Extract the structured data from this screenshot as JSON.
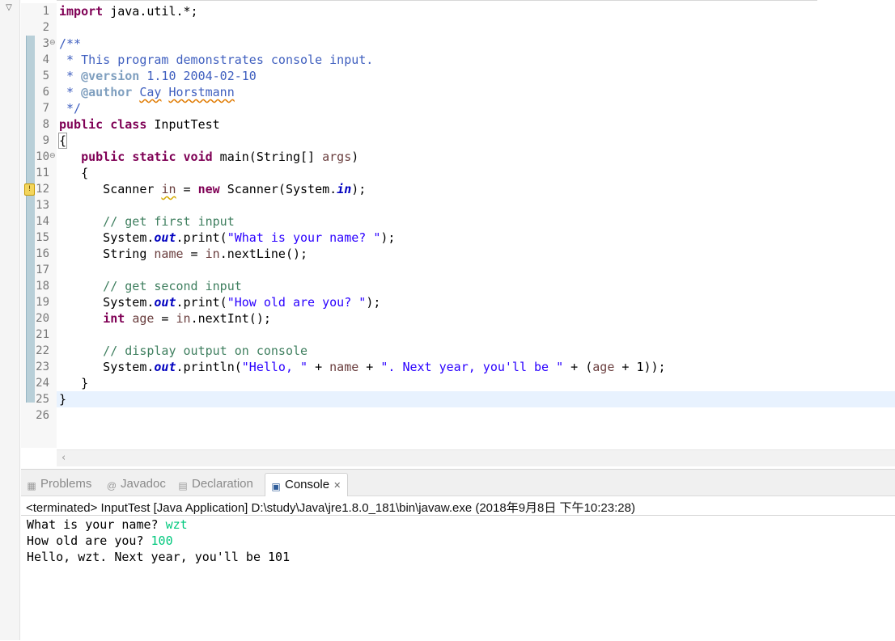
{
  "editor": {
    "lines": [
      {
        "n": "1",
        "fold": "",
        "segs": [
          {
            "t": "import",
            "c": "kw"
          },
          {
            "t": " java.util.*;",
            "c": ""
          }
        ]
      },
      {
        "n": "2",
        "fold": "",
        "segs": []
      },
      {
        "n": "3",
        "fold": "⊖",
        "segs": [
          {
            "t": "/**",
            "c": "jd"
          }
        ]
      },
      {
        "n": "4",
        "fold": "",
        "segs": [
          {
            "t": " * This program demonstrates console input.",
            "c": "jd"
          }
        ]
      },
      {
        "n": "5",
        "fold": "",
        "segs": [
          {
            "t": " * ",
            "c": "jd"
          },
          {
            "t": "@version",
            "c": "jt"
          },
          {
            "t": " 1.10 2004-02-10",
            "c": "jd"
          }
        ]
      },
      {
        "n": "6",
        "fold": "",
        "segs": [
          {
            "t": " * ",
            "c": "jd"
          },
          {
            "t": "@author",
            "c": "jt"
          },
          {
            "t": " ",
            "c": "jd"
          },
          {
            "t": "Cay",
            "c": "jd sq-r"
          },
          {
            "t": " ",
            "c": "jd"
          },
          {
            "t": "Horstmann",
            "c": "jd sq-r"
          }
        ]
      },
      {
        "n": "7",
        "fold": "",
        "segs": [
          {
            "t": " */",
            "c": "jd"
          }
        ]
      },
      {
        "n": "8",
        "fold": "",
        "segs": [
          {
            "t": "public",
            "c": "kw"
          },
          {
            "t": " ",
            "c": ""
          },
          {
            "t": "class",
            "c": "kw"
          },
          {
            "t": " InputTest",
            "c": ""
          }
        ]
      },
      {
        "n": "9",
        "fold": "",
        "segs": [
          {
            "t": "{",
            "c": "brace-box"
          }
        ]
      },
      {
        "n": "10",
        "fold": "⊖",
        "segs": [
          {
            "t": "   ",
            "c": ""
          },
          {
            "t": "public",
            "c": "kw"
          },
          {
            "t": " ",
            "c": ""
          },
          {
            "t": "static",
            "c": "kw"
          },
          {
            "t": " ",
            "c": ""
          },
          {
            "t": "void",
            "c": "kw"
          },
          {
            "t": " main(String[] ",
            "c": ""
          },
          {
            "t": "args",
            "c": "var"
          },
          {
            "t": ")",
            "c": ""
          }
        ]
      },
      {
        "n": "11",
        "fold": "",
        "segs": [
          {
            "t": "   {",
            "c": ""
          }
        ]
      },
      {
        "n": "12",
        "fold": "",
        "warn": true,
        "segs": [
          {
            "t": "      Scanner ",
            "c": ""
          },
          {
            "t": "in",
            "c": "var sq"
          },
          {
            "t": " = ",
            "c": ""
          },
          {
            "t": "new",
            "c": "kw"
          },
          {
            "t": " Scanner(System.",
            "c": ""
          },
          {
            "t": "in",
            "c": "fld"
          },
          {
            "t": ");",
            "c": ""
          }
        ]
      },
      {
        "n": "13",
        "fold": "",
        "segs": []
      },
      {
        "n": "14",
        "fold": "",
        "segs": [
          {
            "t": "      // get first input",
            "c": "cm"
          }
        ]
      },
      {
        "n": "15",
        "fold": "",
        "segs": [
          {
            "t": "      System.",
            "c": ""
          },
          {
            "t": "out",
            "c": "fld"
          },
          {
            "t": ".print(",
            "c": ""
          },
          {
            "t": "\"What is your name? \"",
            "c": "st"
          },
          {
            "t": ");",
            "c": ""
          }
        ]
      },
      {
        "n": "16",
        "fold": "",
        "segs": [
          {
            "t": "      String ",
            "c": ""
          },
          {
            "t": "name",
            "c": "var"
          },
          {
            "t": " = ",
            "c": ""
          },
          {
            "t": "in",
            "c": "var"
          },
          {
            "t": ".nextLine();",
            "c": ""
          }
        ]
      },
      {
        "n": "17",
        "fold": "",
        "segs": []
      },
      {
        "n": "18",
        "fold": "",
        "segs": [
          {
            "t": "      // get second input",
            "c": "cm"
          }
        ]
      },
      {
        "n": "19",
        "fold": "",
        "segs": [
          {
            "t": "      System.",
            "c": ""
          },
          {
            "t": "out",
            "c": "fld"
          },
          {
            "t": ".print(",
            "c": ""
          },
          {
            "t": "\"How old are you? \"",
            "c": "st"
          },
          {
            "t": ");",
            "c": ""
          }
        ]
      },
      {
        "n": "20",
        "fold": "",
        "segs": [
          {
            "t": "      ",
            "c": ""
          },
          {
            "t": "int",
            "c": "kw"
          },
          {
            "t": " ",
            "c": ""
          },
          {
            "t": "age",
            "c": "var"
          },
          {
            "t": " = ",
            "c": ""
          },
          {
            "t": "in",
            "c": "var"
          },
          {
            "t": ".nextInt();",
            "c": ""
          }
        ]
      },
      {
        "n": "21",
        "fold": "",
        "segs": []
      },
      {
        "n": "22",
        "fold": "",
        "segs": [
          {
            "t": "      // display output on console",
            "c": "cm"
          }
        ]
      },
      {
        "n": "23",
        "fold": "",
        "segs": [
          {
            "t": "      System.",
            "c": ""
          },
          {
            "t": "out",
            "c": "fld"
          },
          {
            "t": ".println(",
            "c": ""
          },
          {
            "t": "\"Hello, \"",
            "c": "st"
          },
          {
            "t": " + ",
            "c": ""
          },
          {
            "t": "name",
            "c": "var"
          },
          {
            "t": " + ",
            "c": ""
          },
          {
            "t": "\". Next year, you'll be \"",
            "c": "st"
          },
          {
            "t": " + (",
            "c": ""
          },
          {
            "t": "age",
            "c": "var"
          },
          {
            "t": " + 1));",
            "c": ""
          }
        ]
      },
      {
        "n": "24",
        "fold": "",
        "segs": [
          {
            "t": "   }",
            "c": ""
          }
        ]
      },
      {
        "n": "25",
        "fold": "",
        "segs": [
          {
            "t": "}",
            "c": ""
          }
        ]
      },
      {
        "n": "26",
        "fold": "",
        "segs": []
      }
    ],
    "scroll_left_icon": "‹"
  },
  "panel": {
    "tabs": [
      {
        "label": "Problems",
        "icon": "problems-icon",
        "glyph": "▦",
        "active": false
      },
      {
        "label": "Javadoc",
        "icon": "javadoc-icon",
        "glyph": "@",
        "active": false
      },
      {
        "label": "Declaration",
        "icon": "declaration-icon",
        "glyph": "▤",
        "active": false
      },
      {
        "label": "Console",
        "icon": "console-icon",
        "glyph": "▣",
        "active": true
      }
    ],
    "close_glyph": "✕",
    "console_status": "<terminated> InputTest [Java Application] D:\\study\\Java\\jre1.8.0_181\\bin\\javaw.exe (2018年9月8日 下午10:23:28)",
    "output": [
      {
        "prompt": "What is your name? ",
        "input": "wzt"
      },
      {
        "prompt": "How old are you? ",
        "input": "100"
      },
      {
        "prompt": "Hello, wzt. Next year, you'll be 101",
        "input": ""
      }
    ]
  },
  "colors": {
    "keyword": "#7f0055",
    "comment": "#3f7f5f",
    "javadoc": "#3f5fbf",
    "string": "#2a00ff",
    "field": "#0000c0",
    "local_var": "#6a3e3e",
    "console_input": "#00c87d",
    "current_line": "#e8f2fe"
  }
}
